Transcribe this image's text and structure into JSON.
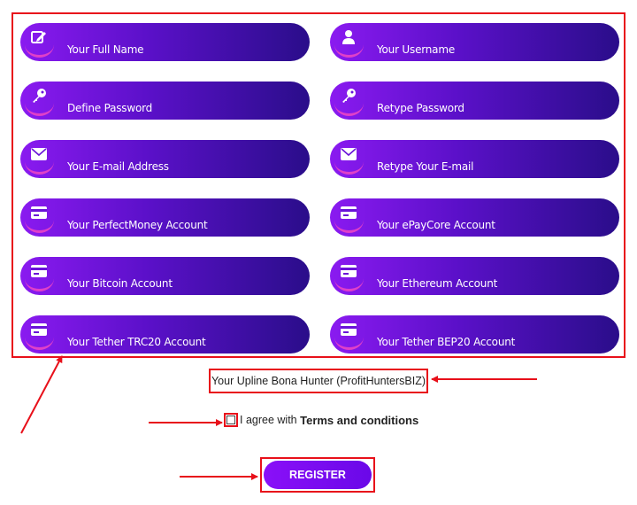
{
  "form": {
    "fields": [
      {
        "placeholder": "Your Full Name",
        "icon": "edit-icon"
      },
      {
        "placeholder": "Your Username",
        "icon": "user-icon"
      },
      {
        "placeholder": "Define Password",
        "icon": "key-icon"
      },
      {
        "placeholder": "Retype Password",
        "icon": "key-icon"
      },
      {
        "placeholder": "Your E-mail Address",
        "icon": "envelope-icon"
      },
      {
        "placeholder": "Retype Your E-mail",
        "icon": "envelope-icon"
      },
      {
        "placeholder": "Your PerfectMoney Account",
        "icon": "card-icon"
      },
      {
        "placeholder": "Your ePayCore Account",
        "icon": "card-icon"
      },
      {
        "placeholder": "Your Bitcoin Account",
        "icon": "card-icon"
      },
      {
        "placeholder": "Your Ethereum Account",
        "icon": "card-icon"
      },
      {
        "placeholder": "Your Tether TRC20 Account",
        "icon": "card-icon"
      },
      {
        "placeholder": "Your Tether BEP20 Account",
        "icon": "card-icon"
      }
    ]
  },
  "upline": {
    "text": "Your Upline Bona Hunter (ProfitHuntersBIZ)"
  },
  "agree": {
    "prefix": "I agree with",
    "terms_link": "Terms and conditions",
    "checked": false
  },
  "register": {
    "label": "REGISTER"
  },
  "colors": {
    "field_gradient_start": "#8a1af0",
    "field_gradient_end": "#2a0d8a",
    "button": "#7a0cf0",
    "annotation": "#e8101a"
  }
}
